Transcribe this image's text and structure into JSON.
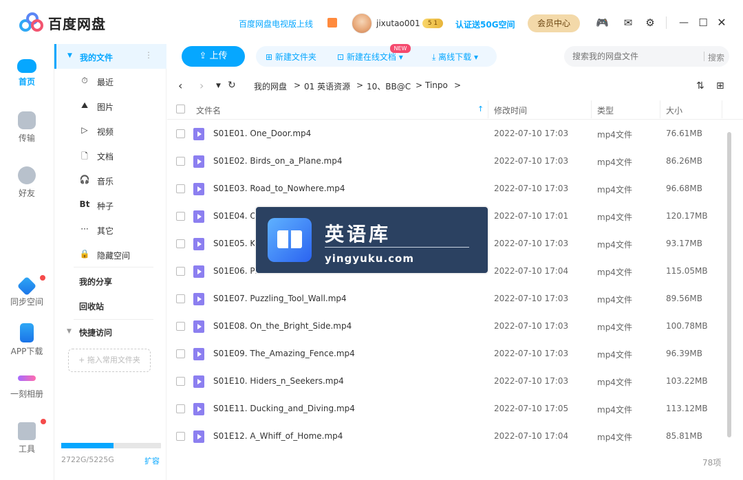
{
  "app": {
    "name": "百度网盘"
  },
  "header": {
    "promo_link": "百度网盘电视版上线",
    "username": "jixutao001",
    "vip_level": "5 1",
    "verify_link": "认证送50G空间",
    "member_button": "会员中心"
  },
  "rail": {
    "items": [
      {
        "label": "首页"
      },
      {
        "label": "传输"
      },
      {
        "label": "好友"
      },
      {
        "label": "同步空间"
      },
      {
        "label": "APP下载"
      },
      {
        "label": "一刻相册"
      },
      {
        "label": "工具"
      }
    ]
  },
  "sidenav": {
    "my_files": "我的文件",
    "items": [
      {
        "icon": "⏱",
        "label": "最近"
      },
      {
        "icon": "⛰",
        "label": "图片"
      },
      {
        "icon": "▷",
        "label": "视频"
      },
      {
        "icon": "🗋",
        "label": "文档"
      },
      {
        "icon": "🎧",
        "label": "音乐"
      },
      {
        "icon": "Bt",
        "label": "种子"
      },
      {
        "icon": "···",
        "label": "其它"
      },
      {
        "icon": "🔒",
        "label": "隐藏空间"
      }
    ],
    "my_share": "我的分享",
    "recycle": "回收站",
    "quick_access": "快捷访问",
    "dropzone": "+ 拖入常用文件夹",
    "storage_text": "2722G/5225G",
    "storage_used_fraction": 0.521,
    "expand": "扩容"
  },
  "toolbar": {
    "upload": "上传",
    "new_folder": "新建文件夹",
    "new_online_doc": "新建在线文档",
    "new_badge": "NEW",
    "offline_download": "离线下载",
    "search_placeholder": "搜索我的网盘文件",
    "search_button": "搜索"
  },
  "breadcrumb": {
    "items": [
      "我的网盘",
      ">",
      "01 英语资源",
      ">",
      "10、BB@C",
      ">",
      "Tinpo",
      ">"
    ]
  },
  "table": {
    "headers": {
      "name": "文件名",
      "modified": "修改时间",
      "type": "类型",
      "size": "大小"
    },
    "rows": [
      {
        "name": "S01E01. One_Door.mp4",
        "modified": "2022-07-10 17:03",
        "type": "mp4文件",
        "size": "76.61MB"
      },
      {
        "name": "S01E02. Birds_on_a_Plane.mp4",
        "modified": "2022-07-10 17:03",
        "type": "mp4文件",
        "size": "86.26MB"
      },
      {
        "name": "S01E03. Road_to_Nowhere.mp4",
        "modified": "2022-07-10 17:03",
        "type": "mp4文件",
        "size": "96.68MB"
      },
      {
        "name": "S01E04. O",
        "modified": "2022-07-10 17:01",
        "type": "mp4文件",
        "size": "120.17MB"
      },
      {
        "name": "S01E05. K",
        "modified": "2022-07-10 17:03",
        "type": "mp4文件",
        "size": "93.17MB"
      },
      {
        "name": "S01E06. Pi",
        "modified": "2022-07-10 17:04",
        "type": "mp4文件",
        "size": "115.05MB"
      },
      {
        "name": "S01E07. Puzzling_Tool_Wall.mp4",
        "modified": "2022-07-10 17:03",
        "type": "mp4文件",
        "size": "89.56MB"
      },
      {
        "name": "S01E08. On_the_Bright_Side.mp4",
        "modified": "2022-07-10 17:03",
        "type": "mp4文件",
        "size": "100.78MB"
      },
      {
        "name": "S01E09. The_Amazing_Fence.mp4",
        "modified": "2022-07-10 17:03",
        "type": "mp4文件",
        "size": "96.39MB"
      },
      {
        "name": "S01E10. Hiders_n_Seekers.mp4",
        "modified": "2022-07-10 17:03",
        "type": "mp4文件",
        "size": "103.22MB"
      },
      {
        "name": "S01E11. Ducking_and_Diving.mp4",
        "modified": "2022-07-10 17:05",
        "type": "mp4文件",
        "size": "113.12MB"
      },
      {
        "name": "S01E12. A_Whiff_of_Home.mp4",
        "modified": "2022-07-10 17:04",
        "type": "mp4文件",
        "size": "85.81MB"
      }
    ]
  },
  "footer": {
    "count": "78项"
  },
  "watermark": {
    "title": "英语库",
    "url": "yingyuku.com"
  },
  "colors": {
    "accent": "#06a7ff",
    "file_icon": "#8c7ff0",
    "badge": "#f54a6e"
  }
}
